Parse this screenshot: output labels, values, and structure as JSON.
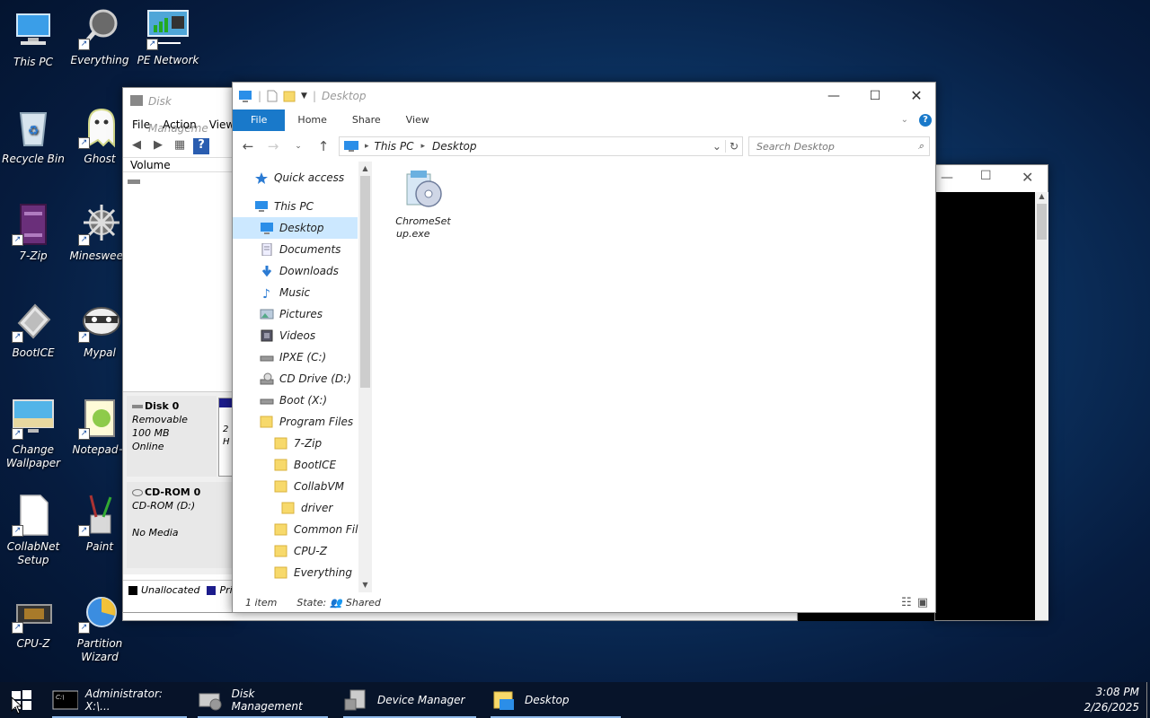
{
  "desktop_icons": [
    {
      "label": "This PC",
      "icon": "computer-icon"
    },
    {
      "label": "Everything",
      "icon": "magnifier-icon"
    },
    {
      "label": "PE Network",
      "icon": "network-icon"
    },
    {
      "label": "Recycle Bin",
      "icon": "recycle-bin-icon"
    },
    {
      "label": "Ghost",
      "icon": "ghost-icon"
    },
    {
      "label": "7-Zip",
      "icon": "archive-icon"
    },
    {
      "label": "Minesweep",
      "icon": "mine-icon"
    },
    {
      "label": "BootICE",
      "icon": "bootice-icon"
    },
    {
      "label": "Mypal",
      "icon": "raccoon-icon"
    },
    {
      "label": "Change Wallpaper",
      "icon": "wallpaper-icon"
    },
    {
      "label": "Notepad+",
      "icon": "notepad-icon"
    },
    {
      "label": "CollabNet Setup",
      "icon": "file-icon"
    },
    {
      "label": "Paint",
      "icon": "paint-icon"
    },
    {
      "label": "CPU-Z",
      "icon": "chip-icon"
    },
    {
      "label": "Partition Wizard",
      "icon": "wizard-icon"
    }
  ],
  "disk_mgmt": {
    "title": "Disk Manageme",
    "menu": [
      "File",
      "Action",
      "View"
    ],
    "column": "Volume",
    "disk0": {
      "name": "Disk 0",
      "type": "Removable",
      "size": "100 MB",
      "status": "Online",
      "part_a": "2",
      "part_b": "H"
    },
    "cdrom": {
      "name": "CD-ROM 0",
      "type": "CD-ROM (D:)",
      "status": "No Media"
    },
    "legend": {
      "unallocated": "Unallocated",
      "primary": "Pri"
    }
  },
  "explorer": {
    "title": "Desktop",
    "ribbon": [
      "File",
      "Home",
      "Share",
      "View"
    ],
    "breadcrumb": [
      "This PC",
      "Desktop"
    ],
    "search_placeholder": "Search Desktop",
    "nav": [
      {
        "label": "Quick access",
        "icon": "star-icon",
        "indent": 0
      },
      {
        "label": "This PC",
        "icon": "computer-icon",
        "indent": 0
      },
      {
        "label": "Desktop",
        "icon": "desktop-icon",
        "indent": 1,
        "selected": true
      },
      {
        "label": "Documents",
        "icon": "documents-icon",
        "indent": 1
      },
      {
        "label": "Downloads",
        "icon": "download-icon",
        "indent": 1
      },
      {
        "label": "Music",
        "icon": "music-icon",
        "indent": 1
      },
      {
        "label": "Pictures",
        "icon": "pictures-icon",
        "indent": 1
      },
      {
        "label": "Videos",
        "icon": "videos-icon",
        "indent": 1
      },
      {
        "label": "IPXE (C:)",
        "icon": "drive-icon",
        "indent": 1
      },
      {
        "label": "CD Drive (D:)",
        "icon": "cd-drive-icon",
        "indent": 1
      },
      {
        "label": "Boot (X:)",
        "icon": "drive-icon",
        "indent": 1
      },
      {
        "label": "Program Files",
        "icon": "folder-icon",
        "indent": 2
      },
      {
        "label": "7-Zip",
        "icon": "folder-icon",
        "indent": 3
      },
      {
        "label": "BootICE",
        "icon": "folder-icon",
        "indent": 3
      },
      {
        "label": "CollabVM",
        "icon": "folder-icon",
        "indent": 3
      },
      {
        "label": "driver",
        "icon": "folder-icon",
        "indent": 4
      },
      {
        "label": "Common Files",
        "icon": "folder-icon",
        "indent": 3
      },
      {
        "label": "CPU-Z",
        "icon": "folder-icon",
        "indent": 3
      },
      {
        "label": "Everything",
        "icon": "folder-icon",
        "indent": 3
      }
    ],
    "file": {
      "line1": "ChromeSet",
      "line2": "up.exe"
    },
    "status": {
      "count": "1 item",
      "state_label": "State:",
      "state_value": "Shared"
    }
  },
  "taskbar": {
    "items": [
      {
        "label": "Administrator: X:\\...",
        "icon": "cmd-icon"
      },
      {
        "label": "Disk Management",
        "icon": "disk-mgmt-icon"
      },
      {
        "label": "Device Manager",
        "icon": "device-manager-icon"
      },
      {
        "label": "Desktop",
        "icon": "folder-icon"
      }
    ],
    "time": "3:08 PM",
    "date": "2/26/2025"
  },
  "colors": {
    "accent": "#1979ca",
    "selection": "#cce8ff",
    "taskbar": "#08142a"
  }
}
